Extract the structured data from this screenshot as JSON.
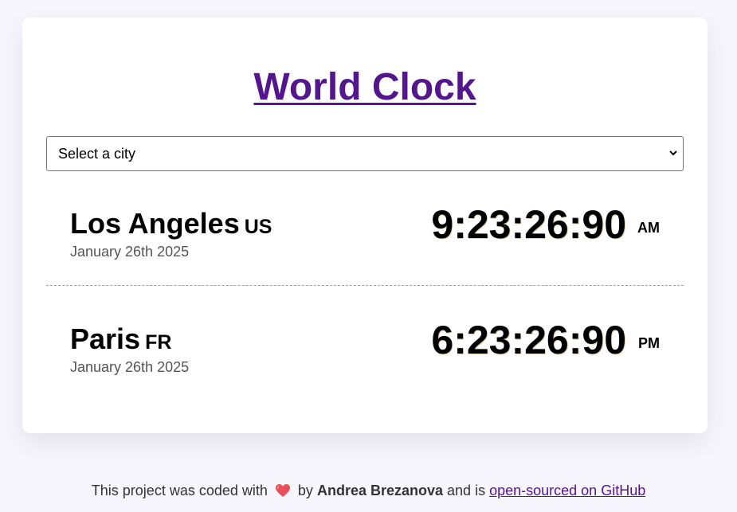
{
  "header": {
    "title": "World Clock"
  },
  "city_select": {
    "selected": "Select a city"
  },
  "cities": [
    {
      "name": "Los Angeles",
      "country": "US",
      "date": "January 26th 2025",
      "time": "9:23:26:90",
      "period": "AM"
    },
    {
      "name": "Paris",
      "country": "FR",
      "date": "January 26th 2025",
      "time": "6:23:26:90",
      "period": "PM"
    }
  ],
  "footer": {
    "prefix": "This project was coded with",
    "by": "by",
    "author": "Andrea Brezanova",
    "middle": "and is",
    "link": "open-sourced on GitHub",
    "heart_icon": "heart-icon"
  },
  "colors": {
    "accent": "#54168c",
    "background": "#f7f6fc",
    "card": "#ffffff"
  }
}
